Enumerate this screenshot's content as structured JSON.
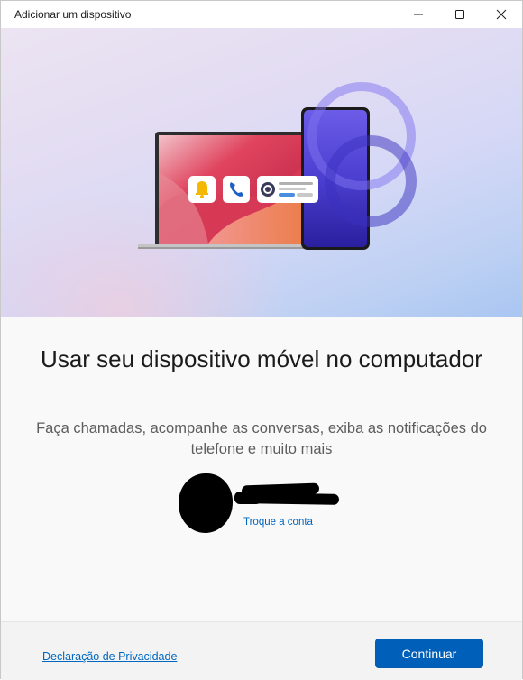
{
  "window": {
    "title": "Adicionar um dispositivo",
    "controls": [
      "minimize-icon",
      "maximize-icon",
      "close-icon"
    ]
  },
  "hero": {
    "illustration": "laptop-and-phone",
    "icons": [
      "bell-icon",
      "phone-call-icon",
      "message-notification-icon"
    ]
  },
  "main": {
    "heading": "Usar seu dispositivo móvel no computador",
    "subtext": "Faça chamadas, acompanhe as conversas, exiba as notificações do telefone e muito mais",
    "account": {
      "switch_link": "Troque a conta"
    }
  },
  "footer": {
    "privacy_link": "Declaração de Privacidade",
    "continue_label": "Continuar"
  },
  "colors": {
    "accent": "#005fb8",
    "link": "#0067c0"
  }
}
